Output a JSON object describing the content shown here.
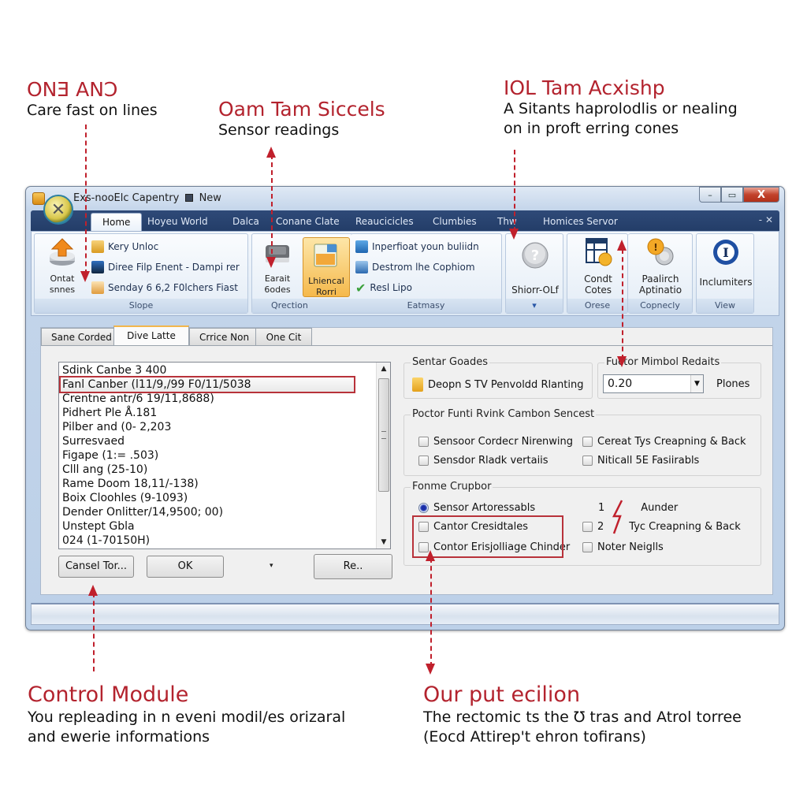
{
  "annotations": {
    "top_left": {
      "title": "ONƎ ANƆ",
      "body": "Care fast on lines"
    },
    "top_center": {
      "title": "Oam Tam Siccels",
      "body": "Sensor readings"
    },
    "top_right": {
      "title": "IOL Tam Acxishp",
      "body_line1": "A Sitants haprolodlis or nealing",
      "body_line2": "on in proft erring cones"
    },
    "bottom_left": {
      "title": "Control Module",
      "body_line1": "You repleading in n eveni modil/es orizaral",
      "body_line2": "and ewerie informations"
    },
    "bottom_right": {
      "title": "Our put ecilion",
      "body_line1": "The rectomic ts the Ʊ tras and Atrol torree",
      "body_line2": "(Eocd Attirep't ehron tofirans)"
    }
  },
  "window": {
    "title": "Exs-nooElc Capentry",
    "title_suffix": "New",
    "controls": {
      "minimize": "–",
      "maximize": "▭",
      "close": "X"
    }
  },
  "ribbon": {
    "tabs": [
      {
        "label": "Home",
        "active": true
      },
      {
        "label": "Hoyeu World"
      },
      {
        "label": "Dalca"
      },
      {
        "label": "Conane Clate"
      },
      {
        "label": "Reaucicicles"
      },
      {
        "label": "Clumbies"
      },
      {
        "label": "Thw"
      },
      {
        "label": "Homices Servor"
      }
    ],
    "right_controls": "- ✕",
    "groups": {
      "slope": {
        "label": "Slope",
        "big_button": "Ontat\nsnnes",
        "items": [
          "Kery Unloc",
          "Diree Filp Enent - Dampi rer",
          "Senday 6 6,2 F0lchers   Fiast"
        ]
      },
      "direction": {
        "label": "Qrection",
        "buttons": [
          "Earait\n6odes",
          "Lhiencal\nRorri"
        ]
      },
      "eatmasy": {
        "label": "Eatmasy",
        "items": [
          "Inperfioat youn buliidn",
          "Destrom lhe Cophiom",
          "Resl Lipo"
        ]
      },
      "help": {
        "label": "▾",
        "button": "Shiorr-OLf"
      },
      "orese": {
        "label": "Orese",
        "button": "Condt\nCotes"
      },
      "copnecly": {
        "label": "Copnecly",
        "button": "Paalirch\nAptinatio"
      },
      "view": {
        "label": "View",
        "button": "Inclumiters"
      }
    }
  },
  "content": {
    "tabs": [
      {
        "label": "Sane Corded"
      },
      {
        "label": "Dive Latte",
        "active": true
      },
      {
        "label": "Crrice Non"
      },
      {
        "label": "One Cit"
      }
    ],
    "list": [
      "Sdink Canbe 3 400",
      "Fanl Canber (l11/9,/99 F0/11/5038",
      "Crentne antr/6 19/11,8688)",
      "Pidhert Ple Å.181",
      "Pilber and (0- 2,203",
      "Surresvaed",
      "Figape (1:= .503)",
      "Clll ang (25-10)",
      "Rame Doom 18,11/-138)",
      "Boix Cloohles (9-1093)",
      "Dender Onlitter/14,9500; 00)",
      "Unstept Gbla",
      "024 (1-70150H)"
    ],
    "selected_index": 1,
    "buttons": {
      "cancel": "Cansel Tor...",
      "ok": "OK",
      "dropdown": "▾",
      "re": "Re.."
    },
    "sensor_grades": {
      "label": "Sentar Goades",
      "item": "Deopn S TV Penvoldd Rlanting"
    },
    "factor_results": {
      "label": "Fuctor Mimbol Redaits",
      "value": "0.20",
      "unit": "Plones"
    },
    "sensor_group": {
      "label": "Poctor Funti Rvink Cambon Sencest",
      "options": [
        {
          "label": "Sensoor Cordecr Nirenwing",
          "checked": false
        },
        {
          "label": "Cereat Tys Creapning & Back",
          "checked": false
        },
        {
          "label": "Sensdor Rladk vertaiis",
          "checked": false
        },
        {
          "label": "Niticall 5E Fasiirabls",
          "checked": false
        }
      ]
    },
    "forme_group": {
      "label": "Fonme Crupbor",
      "radio": "Sensor Artoressabls",
      "left_options": [
        "Cantor Cresidtales",
        "Contor Erisjolliage Chinder"
      ],
      "right_num_1": "1",
      "right_label_1": "Aunder",
      "right_num_2": "2",
      "right_label_2": "Tyc Creapning & Back",
      "right_label_3": "Noter Neiglls"
    }
  }
}
